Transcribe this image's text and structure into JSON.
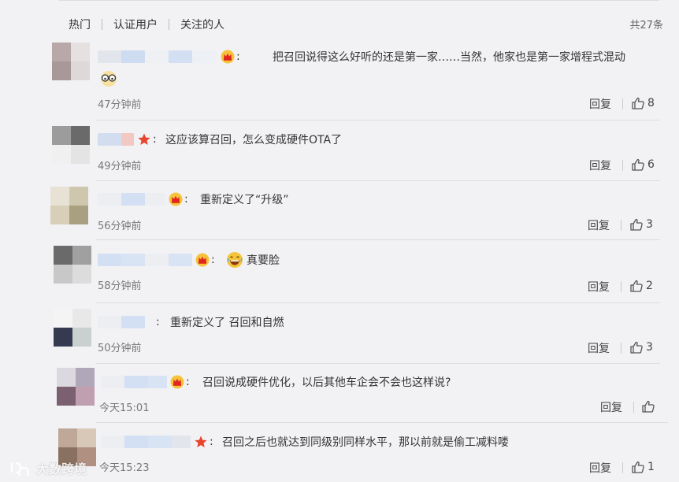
{
  "tabs": [
    "热门",
    "认证用户",
    "关注的人"
  ],
  "total_count": "共27条",
  "reply_label": "回复",
  "colors": {
    "badge_gold": "#e0a020",
    "badge_red": "#e8452c",
    "blur_blue": "#d6e2f5"
  },
  "comments": [
    {
      "text": "把召回说得这么好听的还是第一家……当然，他家也是第一家增程式混动",
      "time": "47分钟前",
      "likes": "8",
      "badge": "crown-badge-icon"
    },
    {
      "text": "这应该算召回，怎么变成硬件OTA了",
      "time": "49分钟前",
      "likes": "6",
      "badge": "star-badge-icon"
    },
    {
      "text": "重新定义了“升级”",
      "time": "56分钟前",
      "likes": "3",
      "badge": "crown-badge-icon"
    },
    {
      "text": "真要脸",
      "time": "58分钟前",
      "likes": "2",
      "badge": "crown-badge-icon"
    },
    {
      "text": "重新定义了 召回和自燃",
      "time": "50分钟前",
      "likes": "3",
      "badge": ""
    },
    {
      "text": "召回说成硬件优化，以后其他车企会不会也这样说?",
      "time": "今天15:01",
      "likes": "",
      "badge": "crown-badge-icon"
    },
    {
      "text": "召回之后也就达到同级别同样水平，那以前就是偷工减料喽",
      "time": "今天15:23",
      "likes": "1",
      "badge": "star-badge-icon"
    }
  ],
  "watermark": "大数跨境"
}
